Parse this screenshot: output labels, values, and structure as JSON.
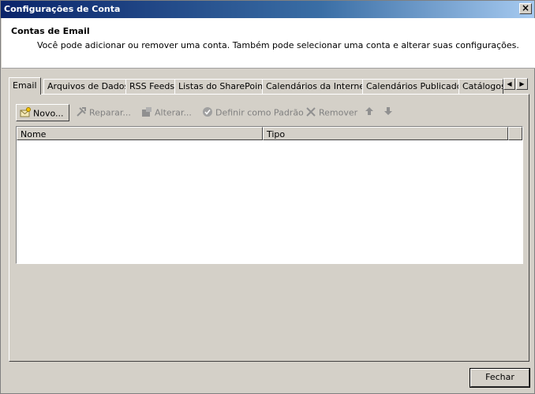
{
  "window": {
    "title": "Configurações de Conta",
    "close_glyph": "×"
  },
  "header": {
    "title": "Contas de Email",
    "description": "Você pode adicionar ou remover uma conta. Também pode selecionar uma conta e alterar suas configurações."
  },
  "tabs": [
    {
      "label": "Email",
      "active": true
    },
    {
      "label": "Arquivos de Dados"
    },
    {
      "label": "RSS Feeds"
    },
    {
      "label": "Listas do SharePoint"
    },
    {
      "label": "Calendários da Internet"
    },
    {
      "label": "Calendários Publicados"
    },
    {
      "label": "Catálogos"
    }
  ],
  "tab_scroll": {
    "left": "◀",
    "right": "▶"
  },
  "toolbar": {
    "new_label": "Novo...",
    "repair_label": "Reparar...",
    "change_label": "Alterar...",
    "set_default_label": "Definir como Padrão",
    "remove_label": "Remover",
    "move_up_icon": "arrow-up-icon",
    "move_down_icon": "arrow-down-icon"
  },
  "list": {
    "columns": [
      "Nome",
      "Tipo"
    ],
    "rows": []
  },
  "footer": {
    "close_label": "Fechar"
  },
  "colors": {
    "titlebar_start": "#0a246a",
    "window_bg": "#d4d0c8",
    "disabled_text": "#808080"
  }
}
